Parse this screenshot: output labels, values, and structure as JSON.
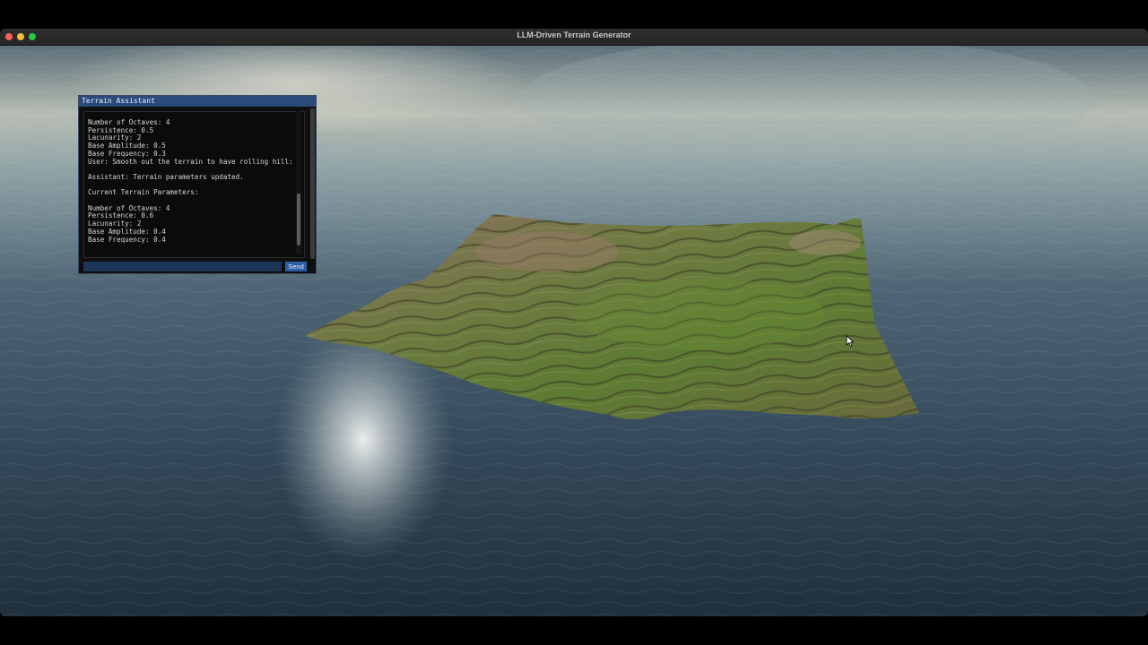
{
  "window": {
    "title": "LLM-Driven Terrain Generator"
  },
  "panel": {
    "title": "Terrain Assistant",
    "chat_lines": [
      "Number of Octaves: 4",
      "Persistence: 0.5",
      "Lacunarity: 2",
      "Base Amplitude: 0.5",
      "Base Frequency: 0.3",
      "User: Smooth out the terrain to have rolling hill:",
      "",
      "Assistant: Terrain parameters updated.",
      "",
      "Current Terrain Parameters:",
      "",
      "Number of Octaves: 4",
      "Persistence: 0.6",
      "Lacunarity: 2",
      "Base Amplitude: 0.4",
      "Base Frequency: 0.4"
    ],
    "input_value": "",
    "send_label": "Send"
  },
  "colors": {
    "header": "#2a4a7c",
    "input": "#1d3556",
    "button": "#2e5fa4",
    "water": "#33495a",
    "grass": "#5f7a34",
    "rock": "#8a6d5e"
  },
  "icons": {
    "close": "red-close-circle",
    "minimize": "yellow-minimize-circle",
    "maximize": "green-maximize-circle",
    "cursor": "arrow-pointer"
  }
}
